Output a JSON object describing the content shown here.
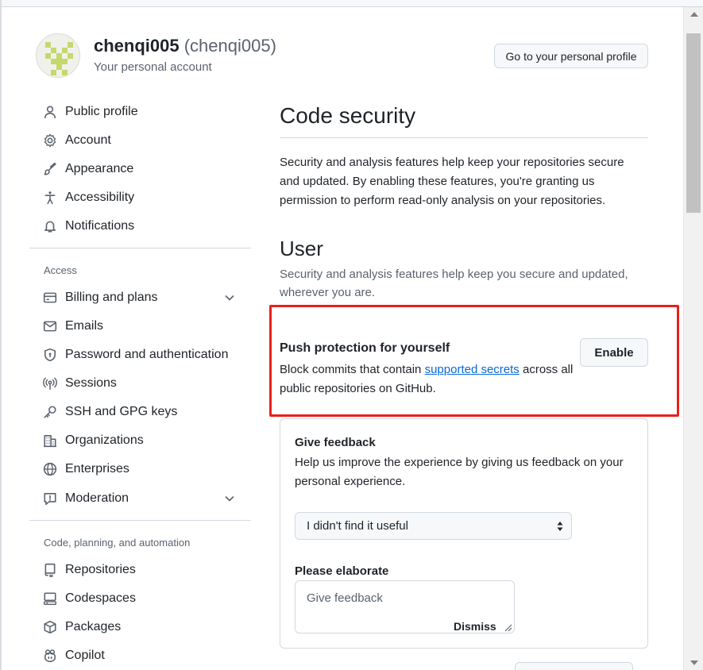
{
  "header": {
    "display_name": "chenqi005",
    "login": "(chenqi005)",
    "subtitle": "Your personal account",
    "profile_button": "Go to your personal profile"
  },
  "sidebar": {
    "items": [
      {
        "label": "Public profile",
        "icon": "person-icon"
      },
      {
        "label": "Account",
        "icon": "gear-icon"
      },
      {
        "label": "Appearance",
        "icon": "paintbrush-icon"
      },
      {
        "label": "Accessibility",
        "icon": "accessibility-icon"
      },
      {
        "label": "Notifications",
        "icon": "bell-icon"
      }
    ],
    "access_heading": "Access",
    "access_items": [
      {
        "label": "Billing and plans",
        "icon": "credit-card-icon"
      },
      {
        "label": "Emails",
        "icon": "mail-icon"
      },
      {
        "label": "Password and authentication",
        "icon": "shield-lock-icon"
      },
      {
        "label": "Sessions",
        "icon": "broadcast-icon"
      },
      {
        "label": "SSH and GPG keys",
        "icon": "key-icon"
      },
      {
        "label": "Organizations",
        "icon": "organization-icon"
      },
      {
        "label": "Enterprises",
        "icon": "globe-icon"
      },
      {
        "label": "Moderation",
        "icon": "report-icon"
      }
    ],
    "code_heading": "Code, planning, and automation",
    "code_items": [
      {
        "label": "Repositories",
        "icon": "repo-icon"
      },
      {
        "label": "Codespaces",
        "icon": "codespaces-icon"
      },
      {
        "label": "Packages",
        "icon": "package-icon"
      },
      {
        "label": "Copilot",
        "icon": "copilot-icon"
      }
    ]
  },
  "main": {
    "title": "Code security",
    "intro": "Security and analysis features help keep your repositories secure and updated. By enabling these features, you're granting us permission to perform read-only analysis on your repositories.",
    "user_heading": "User",
    "user_desc": "Security and analysis features help keep you secure and updated, wherever you are.",
    "push_protection": {
      "title": "Push protection for yourself",
      "desc_before": "Block commits that contain ",
      "link": "supported secrets",
      "desc_after": " across all public repositories on GitHub.",
      "button": "Enable"
    },
    "feedback": {
      "title": "Give feedback",
      "desc": "Help us improve the experience by giving us feedback on your personal experience.",
      "select_value": "I didn't find it useful",
      "elaborate_label": "Please elaborate",
      "placeholder": "Give feedback",
      "dismiss": "Dismiss"
    }
  },
  "colors": {
    "link": "#0969da",
    "highlight": "#e8201a",
    "muted": "#59636e",
    "border": "#d1d9e0"
  }
}
